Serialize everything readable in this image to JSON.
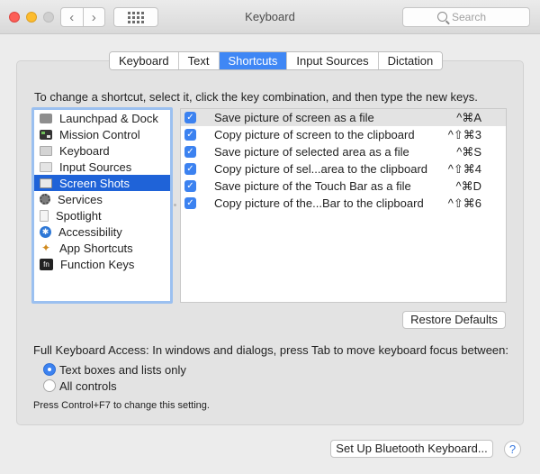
{
  "window": {
    "title": "Keyboard",
    "search_placeholder": "Search",
    "back_glyph": "‹",
    "forward_glyph": "›"
  },
  "tabs": [
    {
      "label": "Keyboard",
      "active": false
    },
    {
      "label": "Text",
      "active": false
    },
    {
      "label": "Shortcuts",
      "active": true
    },
    {
      "label": "Input Sources",
      "active": false
    },
    {
      "label": "Dictation",
      "active": false
    }
  ],
  "instruction": "To change a shortcut, select it, click the key combination, and then type the new keys.",
  "categories": [
    {
      "label": "Launchpad & Dock",
      "icon": "launchpad-icon"
    },
    {
      "label": "Mission Control",
      "icon": "mission-control-icon"
    },
    {
      "label": "Keyboard",
      "icon": "keyboard-icon"
    },
    {
      "label": "Input Sources",
      "icon": "input-sources-icon"
    },
    {
      "label": "Screen Shots",
      "icon": "screenshot-icon",
      "selected": true
    },
    {
      "label": "Services",
      "icon": "services-gear-icon"
    },
    {
      "label": "Spotlight",
      "icon": "spotlight-icon"
    },
    {
      "label": "Accessibility",
      "icon": "accessibility-icon"
    },
    {
      "label": "App Shortcuts",
      "icon": "app-shortcuts-icon"
    },
    {
      "label": "Function Keys",
      "icon": "fn-icon"
    }
  ],
  "shortcuts": [
    {
      "label": "Save picture of screen as a file",
      "keys": "^⌘A",
      "checked": true,
      "highlight": true
    },
    {
      "label": "Copy picture of screen to the clipboard",
      "keys": "^⇧⌘3",
      "checked": true
    },
    {
      "label": "Save picture of selected area as a file",
      "keys": "^⌘S",
      "checked": true
    },
    {
      "label": "Copy picture of sel...area to the clipboard",
      "keys": "^⇧⌘4",
      "checked": true
    },
    {
      "label": "Save picture of the Touch Bar as a file",
      "keys": "^⌘D",
      "checked": true
    },
    {
      "label": "Copy picture of the...Bar to the clipboard",
      "keys": "^⇧⌘6",
      "checked": true
    }
  ],
  "restore_label": "Restore Defaults",
  "fka": {
    "label": "Full Keyboard Access: In windows and dialogs, press Tab to move keyboard focus between:",
    "options": [
      {
        "label": "Text boxes and lists only",
        "selected": true
      },
      {
        "label": "All controls",
        "selected": false
      }
    ],
    "note": "Press Control+F7 to change this setting."
  },
  "bluetooth_label": "Set Up Bluetooth Keyboard...",
  "help_label": "?",
  "colors": {
    "accent": "#3f87f5",
    "selection": "#1f63d8",
    "close": "#fc5f57",
    "minimize": "#fdbc2e"
  }
}
